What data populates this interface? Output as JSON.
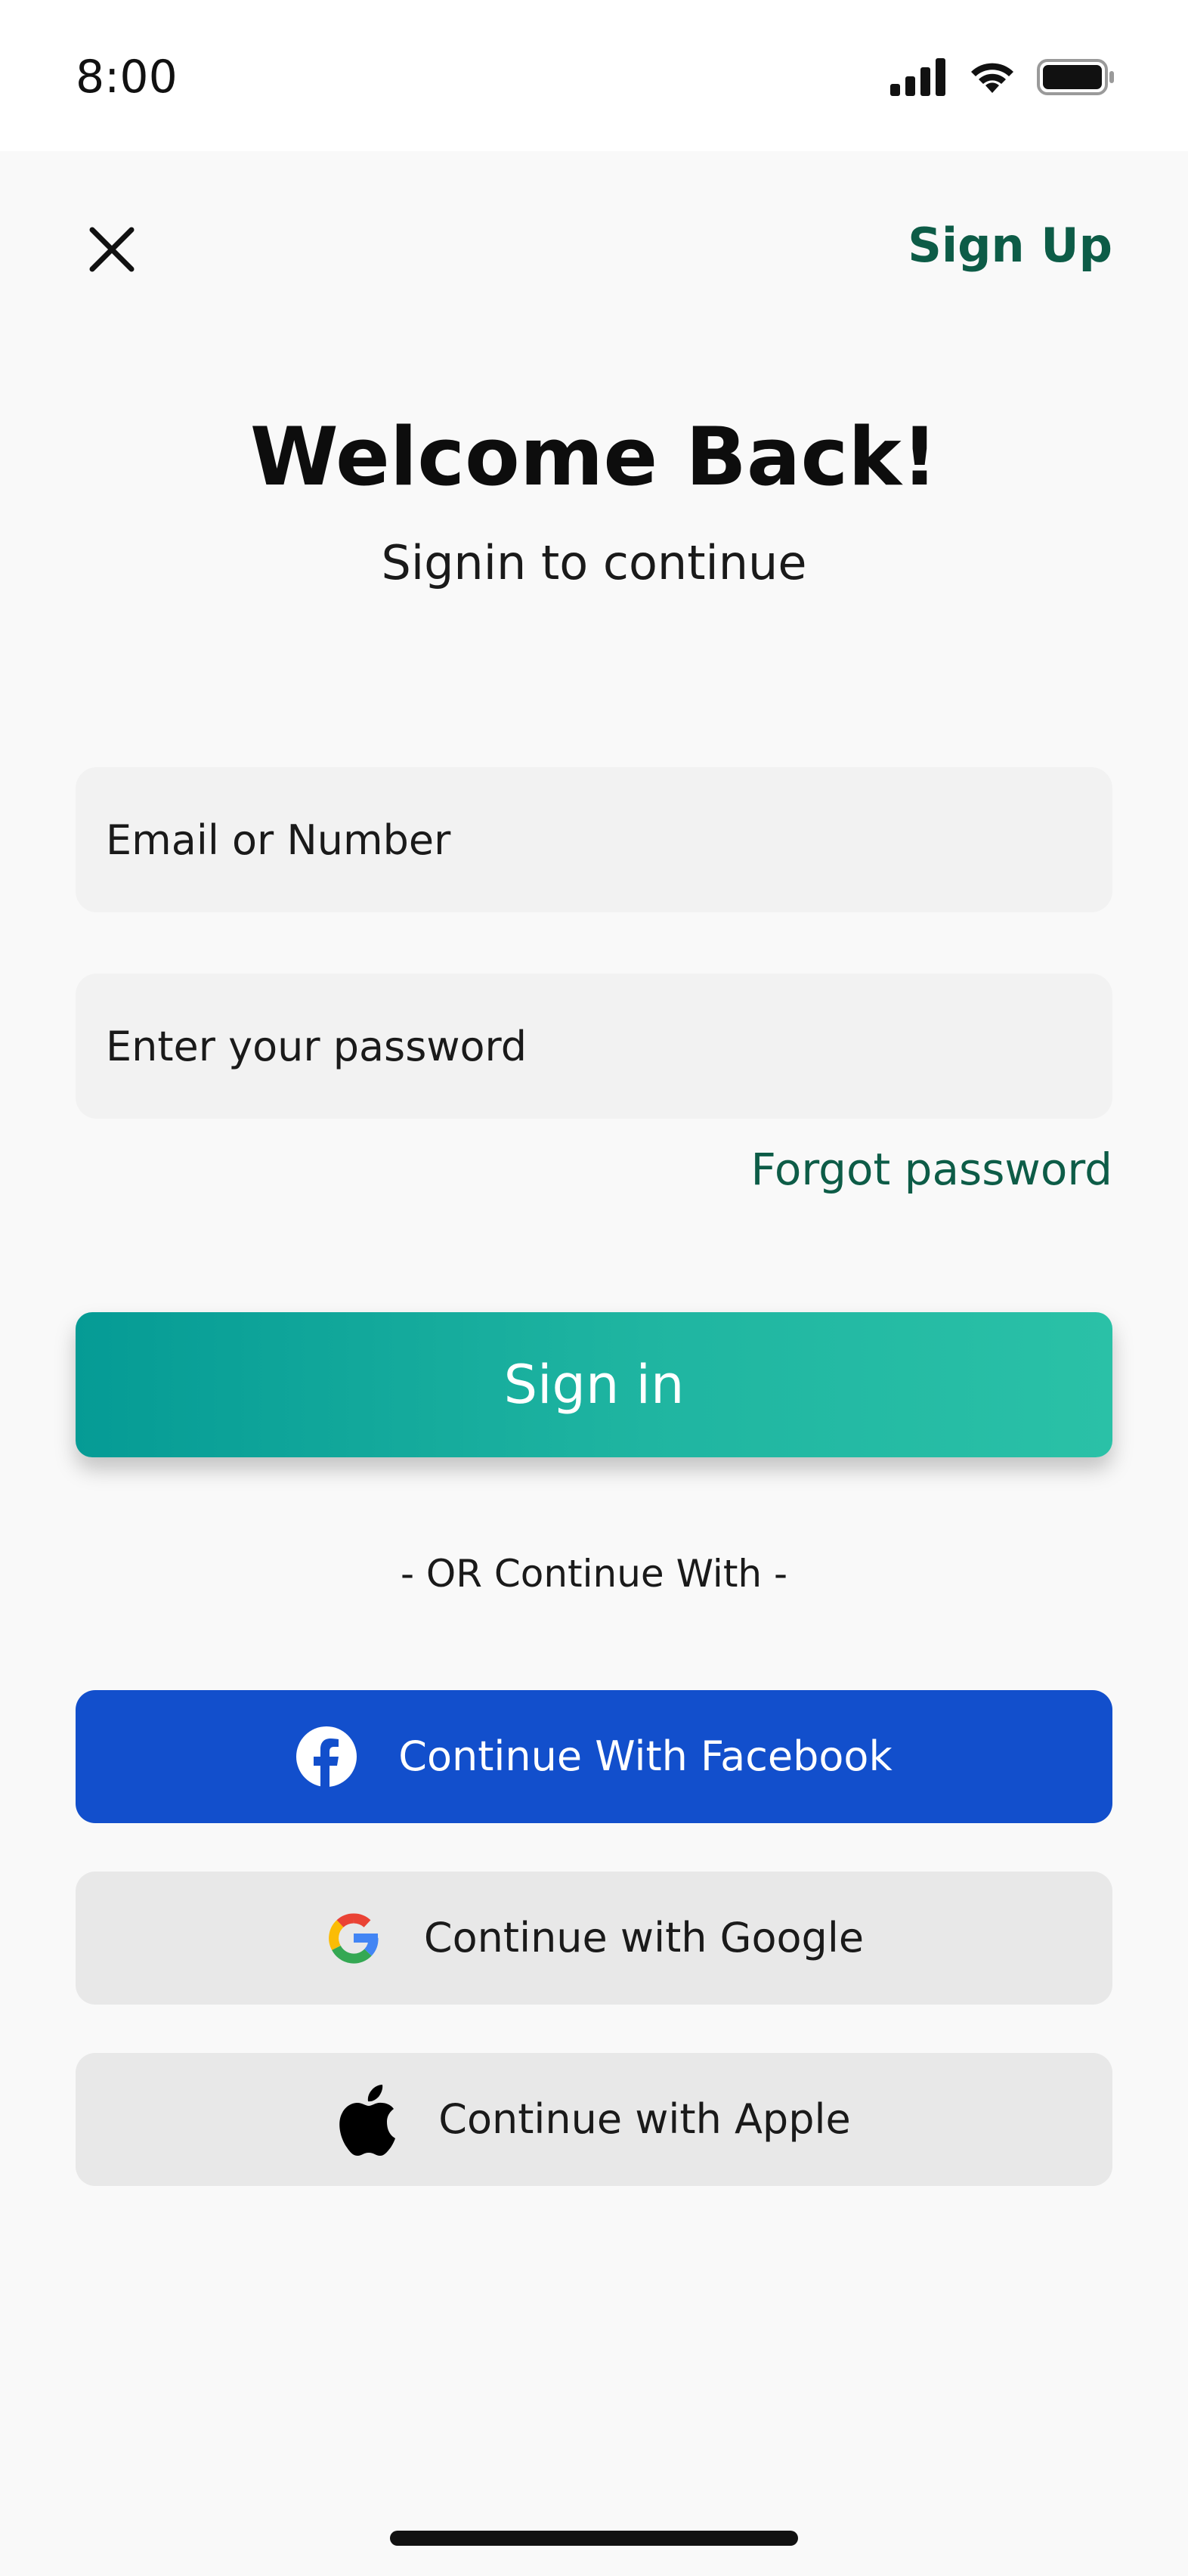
{
  "status_bar": {
    "time": "8:00",
    "icons": [
      "cellular-signal-icon",
      "wifi-icon",
      "battery-icon"
    ]
  },
  "header": {
    "close_icon": "close-icon",
    "signup_label": "Sign Up"
  },
  "intro": {
    "title": "Welcome Back!",
    "subtitle": "Signin to continue"
  },
  "form": {
    "email_placeholder": "Email or Number",
    "email_value": "",
    "password_placeholder": "Enter your password",
    "password_value": "",
    "forgot_label": "Forgot password",
    "signin_label": "Sign in"
  },
  "divider": {
    "label": "- OR Continue With -"
  },
  "social": {
    "facebook_label": "Continue With Facebook",
    "google_label": "Continue with Google",
    "apple_label": "Continue with Apple"
  },
  "colors": {
    "accent": "#0d5c47",
    "signin_gradient_start": "#059b95",
    "signin_gradient_end": "#2ac1a7",
    "facebook_blue": "#124fcc",
    "neutral_button": "#e8e8e8",
    "field_bg": "#f2f2f2",
    "page_bg": "#f9f9f9"
  }
}
